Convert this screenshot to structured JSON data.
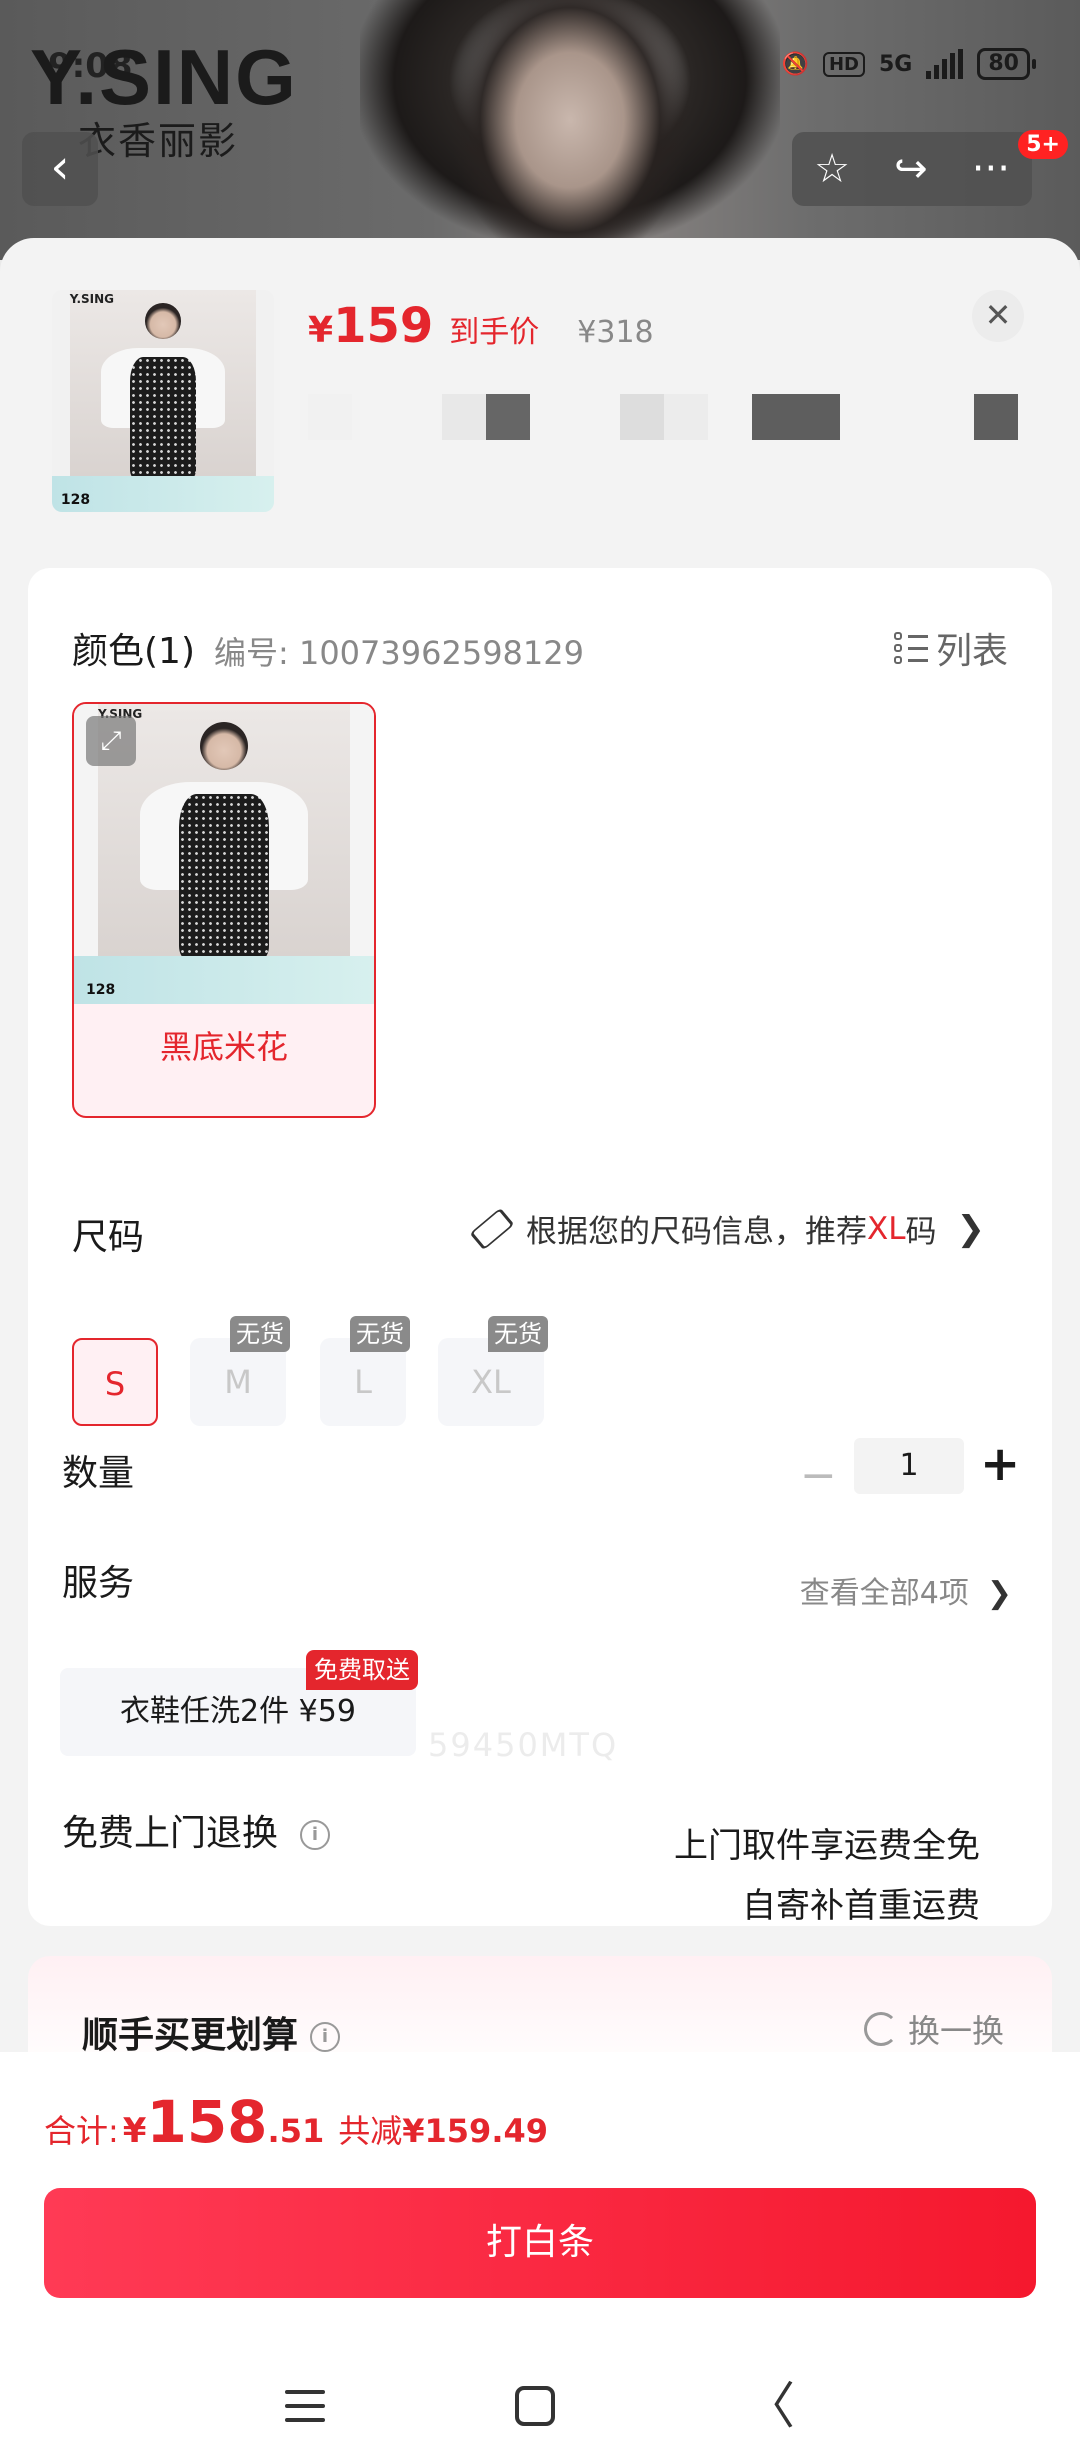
{
  "status_bar": {
    "time": "9:08",
    "network": "5G",
    "hd": "HD",
    "battery": "80"
  },
  "brand": {
    "logo": "Y.SING",
    "cn": "衣香丽影"
  },
  "top_nav": {
    "back_glyph": "‹",
    "star_glyph": "☆",
    "share_glyph": "↪",
    "more_glyph": "···",
    "badge": "5+"
  },
  "sheet": {
    "close_glyph": "✕",
    "price": {
      "yen": "¥",
      "amount": "159",
      "label": "到手价",
      "original": "¥318"
    },
    "thumb": {
      "logo": "Y.SING",
      "price": "128"
    }
  },
  "color": {
    "title": "颜色(1)",
    "code": "编号: 10073962598129",
    "list_label": "列表",
    "options": [
      {
        "name": "黑底米花",
        "logo": "Y.SING",
        "price": "128",
        "zoom_glyph": "⤢"
      }
    ]
  },
  "size": {
    "title": "尺码",
    "hint_prefix": "根据您的尺码信息，推荐",
    "hint_rec": "XL",
    "hint_suffix": "码",
    "options": [
      {
        "label": "S",
        "selected": true
      },
      {
        "label": "M",
        "tag": "无货"
      },
      {
        "label": "L",
        "tag": "无货"
      },
      {
        "label": "XL",
        "tag": "无货"
      }
    ]
  },
  "quantity": {
    "title": "数量",
    "minus": "−",
    "value": "1",
    "plus": "+"
  },
  "service": {
    "title": "服务",
    "view_all": "查看全部4项",
    "chevron": "❯",
    "chip": "衣鞋任洗2件  ¥59",
    "badge": "免费取送"
  },
  "returns": {
    "title": "免费上门退换",
    "info": "i",
    "line1": "上门取件享运费全免",
    "line2": "自寄补首重运费"
  },
  "bundle": {
    "title": "顺手买更划算",
    "info": "i",
    "swap": "换一换"
  },
  "footer": {
    "total_label": "合计:",
    "yen": "¥",
    "total_int": "158",
    "total_dec": ".51",
    "save_label": "共减",
    "save_amount": "¥159.49",
    "pay_button": "打白条"
  },
  "watermark": "59450MTQ",
  "colors": {
    "accent": "#e4262d",
    "button": "#f5182e"
  }
}
